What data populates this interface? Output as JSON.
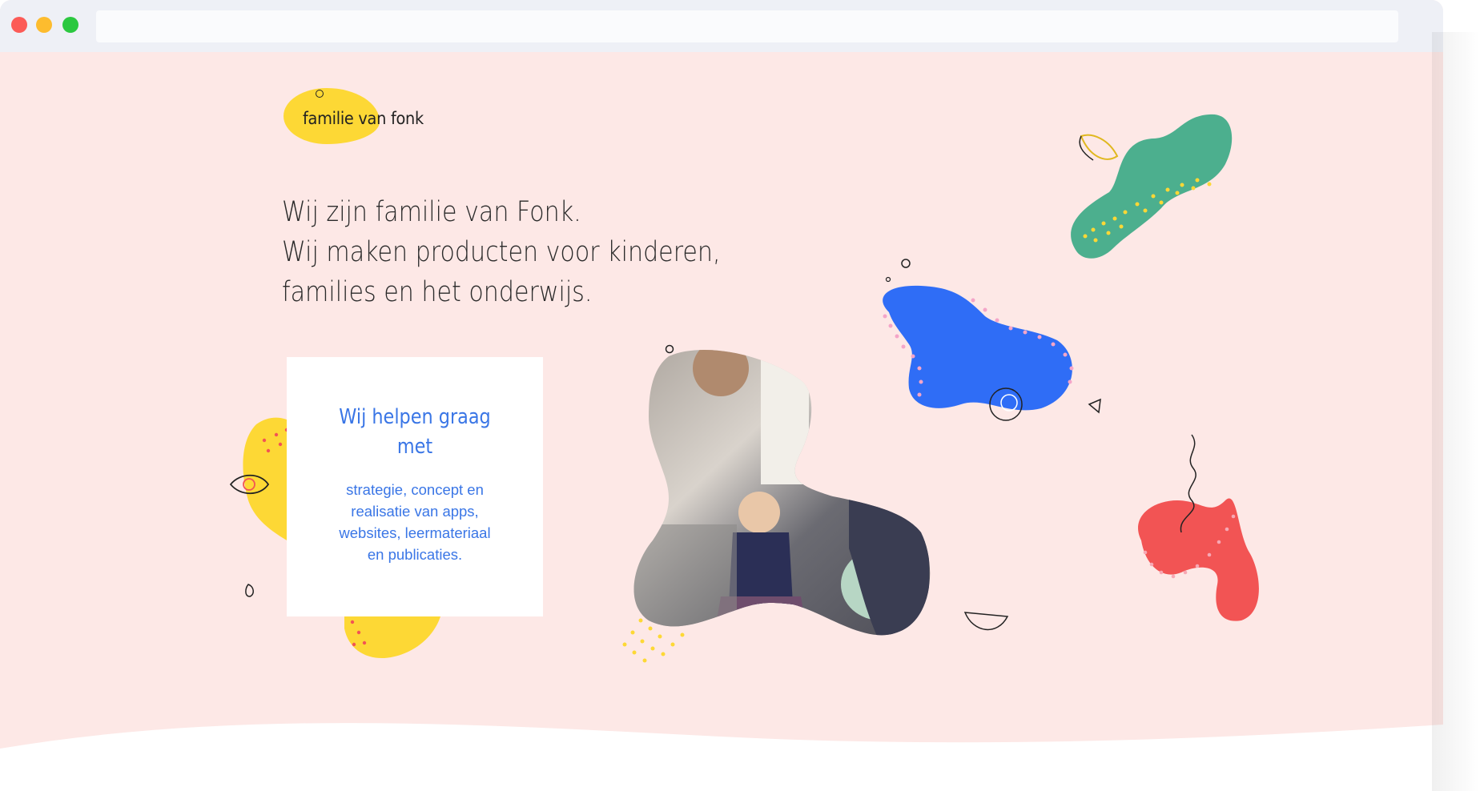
{
  "browser": {
    "url": ""
  },
  "logo": {
    "text": "familie van fonk"
  },
  "hero": {
    "lines": [
      "Wij zijn familie van Fonk.",
      "Wij maken producten voor kinderen,",
      "families en het onderwijs."
    ]
  },
  "card": {
    "title_line1": "Wij helpen graag",
    "title_line2": "met",
    "body_lines": [
      "strategie, concept en",
      "realisatie van apps,",
      "websites, leermateriaal",
      "en publicaties."
    ]
  },
  "colors": {
    "page_background": "#fde8e6",
    "accent_text": "#3a76e6",
    "yellow": "#fdd835",
    "green": "#4caf8e",
    "blue": "#2f6df6",
    "red": "#f25454"
  }
}
